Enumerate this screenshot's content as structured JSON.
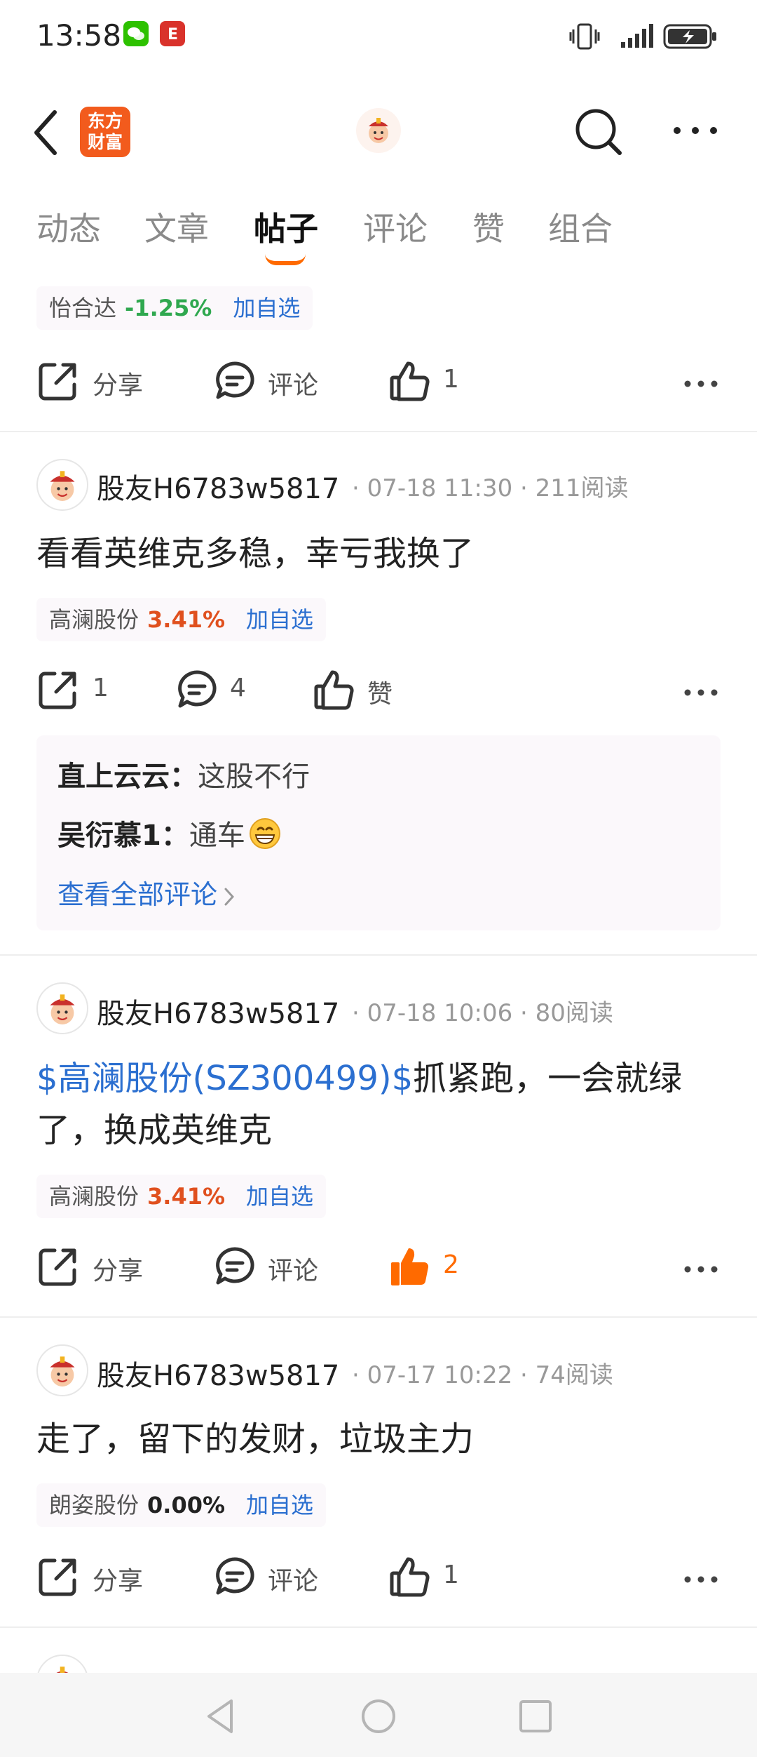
{
  "status": {
    "time": "13:58"
  },
  "header": {
    "logo_line1": "东方",
    "logo_line2": "财富"
  },
  "tabs": [
    {
      "label": "动态"
    },
    {
      "label": "文章"
    },
    {
      "label": "帖子"
    },
    {
      "label": "评论"
    },
    {
      "label": "赞"
    },
    {
      "label": "组合"
    }
  ],
  "top_partial": {
    "stock": {
      "name": "怡合达",
      "pct": "-1.25%",
      "add": "加自选"
    },
    "share": "分享",
    "comment": "评论",
    "likes": "1"
  },
  "posts": [
    {
      "user": "股友H6783w5817",
      "meta": "· 07-18 11:30 · 211阅读",
      "text": "看看英维克多稳，幸亏我换了",
      "stock": {
        "name": "高澜股份",
        "pct": "3.41%",
        "add": "加自选"
      },
      "share": "1",
      "comment": "4",
      "like": "赞",
      "comments": [
        {
          "author": "直上云云",
          "sep": "：",
          "text": "这股不行"
        },
        {
          "author": "吴衍慕1",
          "sep": "：",
          "text": "通车"
        }
      ],
      "view_all": "查看全部评论"
    },
    {
      "user": "股友H6783w5817",
      "meta": "· 07-18 10:06 · 80阅读",
      "text_link": "$高澜股份(SZ300499)$",
      "text_line1_rest": "抓紧跑，一会就绿",
      "text_line2": "了，换成英维克",
      "stock": {
        "name": "高澜股份",
        "pct": "3.41%",
        "add": "加自选"
      },
      "share": "分享",
      "comment": "评论",
      "likes": "2"
    },
    {
      "user": "股友H6783w5817",
      "meta": "· 07-17 10:22 · 74阅读",
      "text": "走了，留下的发财，垃圾主力",
      "stock": {
        "name": "朗姿股份",
        "pct": "0.00%",
        "add": "加自选"
      },
      "share": "分享",
      "comment": "评论",
      "likes": "1"
    }
  ],
  "colors": {
    "up": "#e0501e",
    "down": "#2fa84f",
    "flat": "#222222",
    "accent": "#ff6a00",
    "link": "#2b6fd0"
  }
}
